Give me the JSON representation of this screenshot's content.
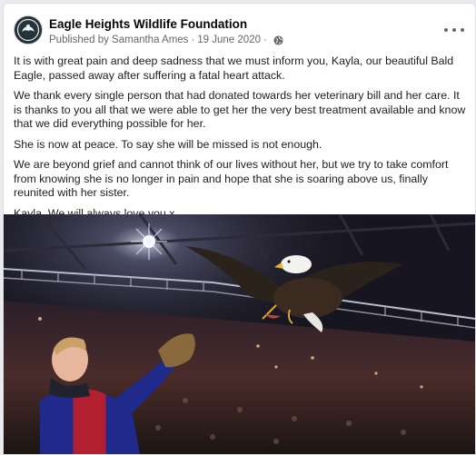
{
  "post": {
    "page_name": "Eagle Heights Wildlife Foundation",
    "published_by": "Published by Samantha Ames",
    "separator": "·",
    "date": "19 June 2020",
    "separator2": "·",
    "privacy_icon": "globe-icon",
    "more_icon": "more-options-icon",
    "paragraphs": [
      "It is with great pain and deep sadness that we must inform you, Kayla, our beautiful Bald Eagle, passed away after suffering a fatal heart attack.",
      "We thank every single person that had donated towards her veterinary bill and her care. It is thanks to you all that we were able to get her the very best treatment available and know that we did everything possible for her.",
      "She is now at peace. To say she will be missed is not enough.",
      "We are beyond grief and cannot think of our lives without her, but we try to take comfort from knowing she is no longer in pain and hope that she is soaring above us, finally reunited with her sister.",
      "Kayla. We will always love you x"
    ]
  },
  "colors": {
    "page_bg": "#e9ebee",
    "card_bg": "#ffffff",
    "name_text": "#050505",
    "meta_text": "#65676b",
    "body_text": "#1c1e21"
  }
}
